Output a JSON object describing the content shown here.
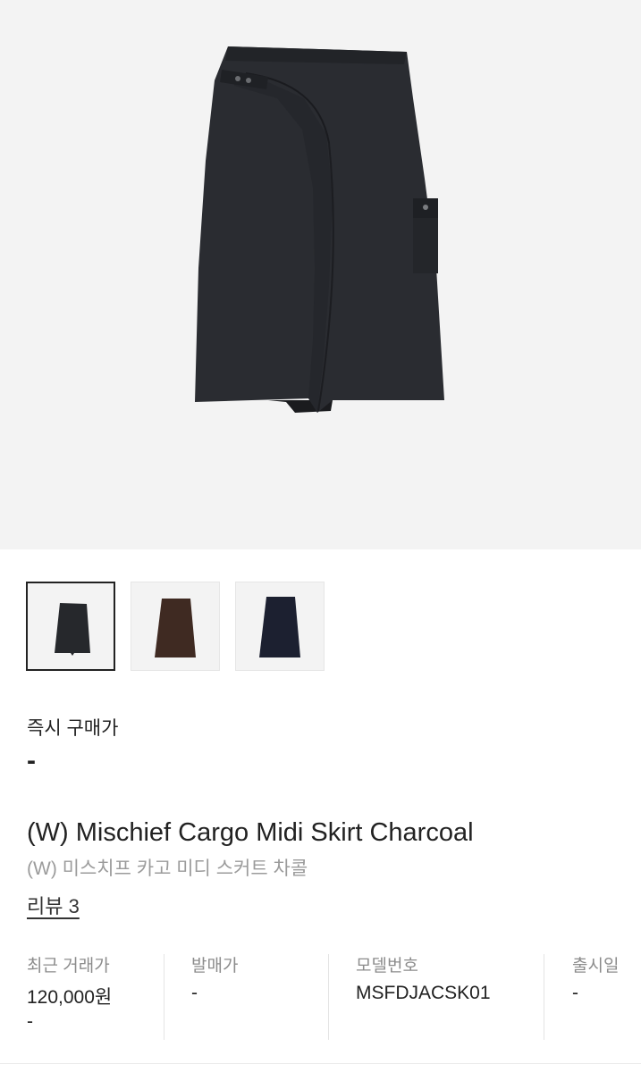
{
  "product_images": {
    "main_alt": "skirt-product-image",
    "thumbnails": [
      {
        "name": "charcoal",
        "color": "#26282c",
        "selected": true
      },
      {
        "name": "brown",
        "color": "#3f2a22",
        "selected": false
      },
      {
        "name": "navy",
        "color": "#1c2030",
        "selected": false
      }
    ]
  },
  "instant_buy": {
    "label": "즉시 구매가",
    "price": "-"
  },
  "product": {
    "title_en": "(W) Mischief Cargo Midi Skirt Charcoal",
    "title_ko": "(W) 미스치프 카고 미디 스커트 차콜",
    "review_label": "리뷰 3"
  },
  "info": {
    "recent_trade": {
      "label": "최근 거래가",
      "value": "120,000원",
      "change": "-"
    },
    "release_price": {
      "label": "발매가",
      "value": "-"
    },
    "model_number": {
      "label": "모델번호",
      "value": "MSFDJACSK01"
    },
    "release_date": {
      "label": "출시일",
      "value": "-"
    }
  },
  "colors": {
    "hero_bg": "#f3f3f3",
    "skirt": "#26282c",
    "text_primary": "#222222",
    "text_secondary": "#9b9b9b"
  }
}
